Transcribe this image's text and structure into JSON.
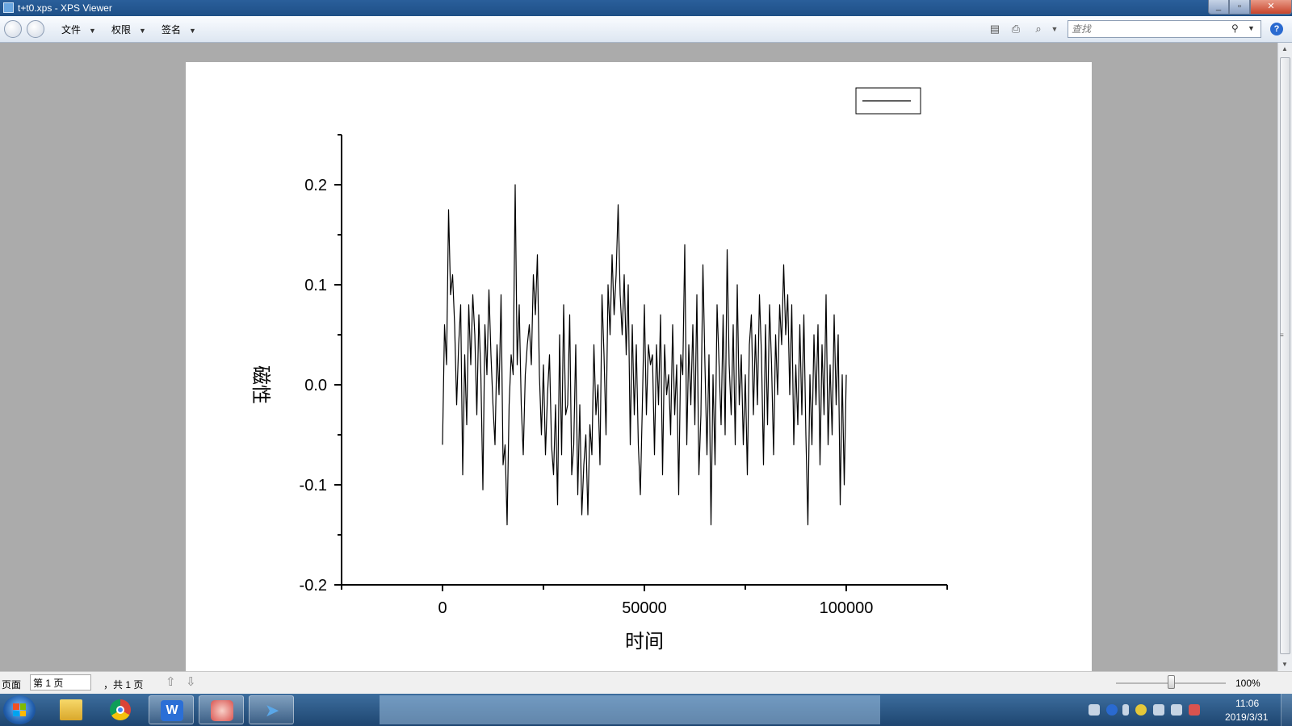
{
  "window": {
    "title": "t+t0.xps - XPS Viewer"
  },
  "toolbar": {
    "menus": [
      {
        "label": "文件"
      },
      {
        "label": "权限"
      },
      {
        "label": "签名"
      }
    ],
    "search_placeholder": "查找"
  },
  "statusbar": {
    "page_label": "页面",
    "page_value": "第 1 页",
    "page_total": "，共 1 页",
    "zoom": "100%",
    "zoom_fraction": 0.5
  },
  "taskbar": {
    "time": "11:06",
    "date": "2019/3/31"
  },
  "chart_data": {
    "type": "line",
    "title": "",
    "xlabel": "时间",
    "ylabel": "磁性",
    "xlim": [
      -25000,
      125000
    ],
    "ylim": [
      -0.2,
      0.25
    ],
    "x_ticks": [
      0,
      50000,
      100000
    ],
    "x_tick_labels": [
      "0",
      "50000",
      "100000"
    ],
    "y_ticks": [
      -0.2,
      -0.1,
      0.0,
      0.1,
      0.2
    ],
    "y_tick_labels": [
      "-0.2",
      "-0.1",
      "0.0",
      "0.1",
      "0.2"
    ],
    "legend": {
      "position": "top-right",
      "entries": [
        ""
      ]
    },
    "series": [
      {
        "color": "#000000",
        "x": [
          0,
          500,
          1000,
          1500,
          2000,
          2500,
          3000,
          3500,
          4000,
          4500,
          5000,
          5500,
          6000,
          6500,
          7000,
          7500,
          8000,
          8500,
          9000,
          9500,
          10000,
          10500,
          11000,
          11500,
          12000,
          12500,
          13000,
          13500,
          14000,
          14500,
          15000,
          15500,
          16000,
          16500,
          17000,
          17500,
          18000,
          18500,
          19000,
          19500,
          20000,
          20500,
          21000,
          21500,
          22000,
          22500,
          23000,
          23500,
          24000,
          24500,
          25000,
          25500,
          26000,
          26500,
          27000,
          27500,
          28000,
          28500,
          29000,
          29500,
          30000,
          30500,
          31000,
          31500,
          32000,
          32500,
          33000,
          33500,
          34000,
          34500,
          35000,
          35500,
          36000,
          36500,
          37000,
          37500,
          38000,
          38500,
          39000,
          39500,
          40000,
          40500,
          41000,
          41500,
          42000,
          42500,
          43000,
          43500,
          44000,
          44500,
          45000,
          45500,
          46000,
          46500,
          47000,
          47500,
          48000,
          48500,
          49000,
          49500,
          50000,
          50500,
          51000,
          51500,
          52000,
          52500,
          53000,
          53500,
          54000,
          54500,
          55000,
          55500,
          56000,
          56500,
          57000,
          57500,
          58000,
          58500,
          59000,
          59500,
          60000,
          60500,
          61000,
          61500,
          62000,
          62500,
          63000,
          63500,
          64000,
          64500,
          65000,
          65500,
          66000,
          66500,
          67000,
          67500,
          68000,
          68500,
          69000,
          69500,
          70000,
          70500,
          71000,
          71500,
          72000,
          72500,
          73000,
          73500,
          74000,
          74500,
          75000,
          75500,
          76000,
          76500,
          77000,
          77500,
          78000,
          78500,
          79000,
          79500,
          80000,
          80500,
          81000,
          81500,
          82000,
          82500,
          83000,
          83500,
          84000,
          84500,
          85000,
          85500,
          86000,
          86500,
          87000,
          87500,
          88000,
          88500,
          89000,
          89500,
          90000,
          90500,
          91000,
          91500,
          92000,
          92500,
          93000,
          93500,
          94000,
          94500,
          95000,
          95500,
          96000,
          96500,
          97000,
          97500,
          98000,
          98500,
          99000,
          99500,
          100000
        ],
        "y": [
          -0.06,
          0.06,
          0.02,
          0.175,
          0.09,
          0.11,
          0.06,
          -0.02,
          0.04,
          0.08,
          -0.09,
          0.03,
          -0.04,
          0.08,
          0.02,
          0.09,
          0.05,
          -0.03,
          0.07,
          0.01,
          -0.105,
          0.06,
          0.01,
          0.095,
          0.03,
          -0.02,
          -0.06,
          0.04,
          -0.01,
          0.09,
          -0.08,
          -0.06,
          -0.14,
          -0.02,
          0.03,
          0.01,
          0.2,
          0.02,
          0.08,
          -0.02,
          -0.07,
          0.01,
          0.04,
          0.06,
          0.02,
          0.11,
          0.07,
          0.13,
          0.01,
          -0.05,
          0.02,
          -0.07,
          -0.01,
          0.03,
          -0.06,
          -0.09,
          -0.02,
          -0.12,
          0.05,
          -0.07,
          0.08,
          -0.03,
          -0.02,
          0.07,
          -0.09,
          -0.06,
          0.04,
          -0.11,
          -0.02,
          -0.13,
          -0.08,
          -0.05,
          -0.13,
          -0.04,
          -0.07,
          0.04,
          -0.03,
          0.0,
          -0.08,
          0.09,
          0.03,
          -0.05,
          0.1,
          0.05,
          0.13,
          0.07,
          0.11,
          0.18,
          0.09,
          0.05,
          0.11,
          0.03,
          0.1,
          -0.06,
          0.06,
          -0.03,
          0.04,
          -0.06,
          -0.11,
          -0.02,
          0.08,
          -0.03,
          0.04,
          0.02,
          0.03,
          -0.07,
          0.04,
          -0.02,
          0.07,
          -0.09,
          0.04,
          -0.01,
          0.01,
          -0.05,
          0.06,
          -0.03,
          0.02,
          -0.11,
          0.03,
          0.01,
          0.14,
          -0.06,
          0.04,
          -0.02,
          0.06,
          -0.04,
          0.09,
          -0.09,
          -0.03,
          0.12,
          0.02,
          -0.07,
          0.03,
          -0.14,
          0.01,
          -0.08,
          0.08,
          0.02,
          -0.04,
          0.07,
          -0.05,
          0.135,
          0.02,
          -0.03,
          0.06,
          -0.06,
          0.1,
          -0.02,
          0.03,
          -0.06,
          0.01,
          -0.09,
          0.04,
          0.07,
          -0.03,
          0.05,
          -0.02,
          0.09,
          0.03,
          -0.08,
          0.06,
          -0.04,
          0.08,
          0.02,
          -0.07,
          0.05,
          -0.01,
          0.08,
          0.04,
          0.12,
          0.05,
          0.09,
          -0.01,
          0.08,
          -0.06,
          0.02,
          -0.04,
          0.06,
          -0.03,
          0.07,
          -0.05,
          -0.14,
          0.01,
          -0.06,
          0.05,
          -0.02,
          0.06,
          -0.08,
          0.04,
          -0.03,
          0.09,
          -0.06,
          0.02,
          -0.05,
          0.07,
          -0.02,
          0.05,
          -0.12,
          0.01,
          -0.1,
          0.01
        ]
      }
    ]
  }
}
